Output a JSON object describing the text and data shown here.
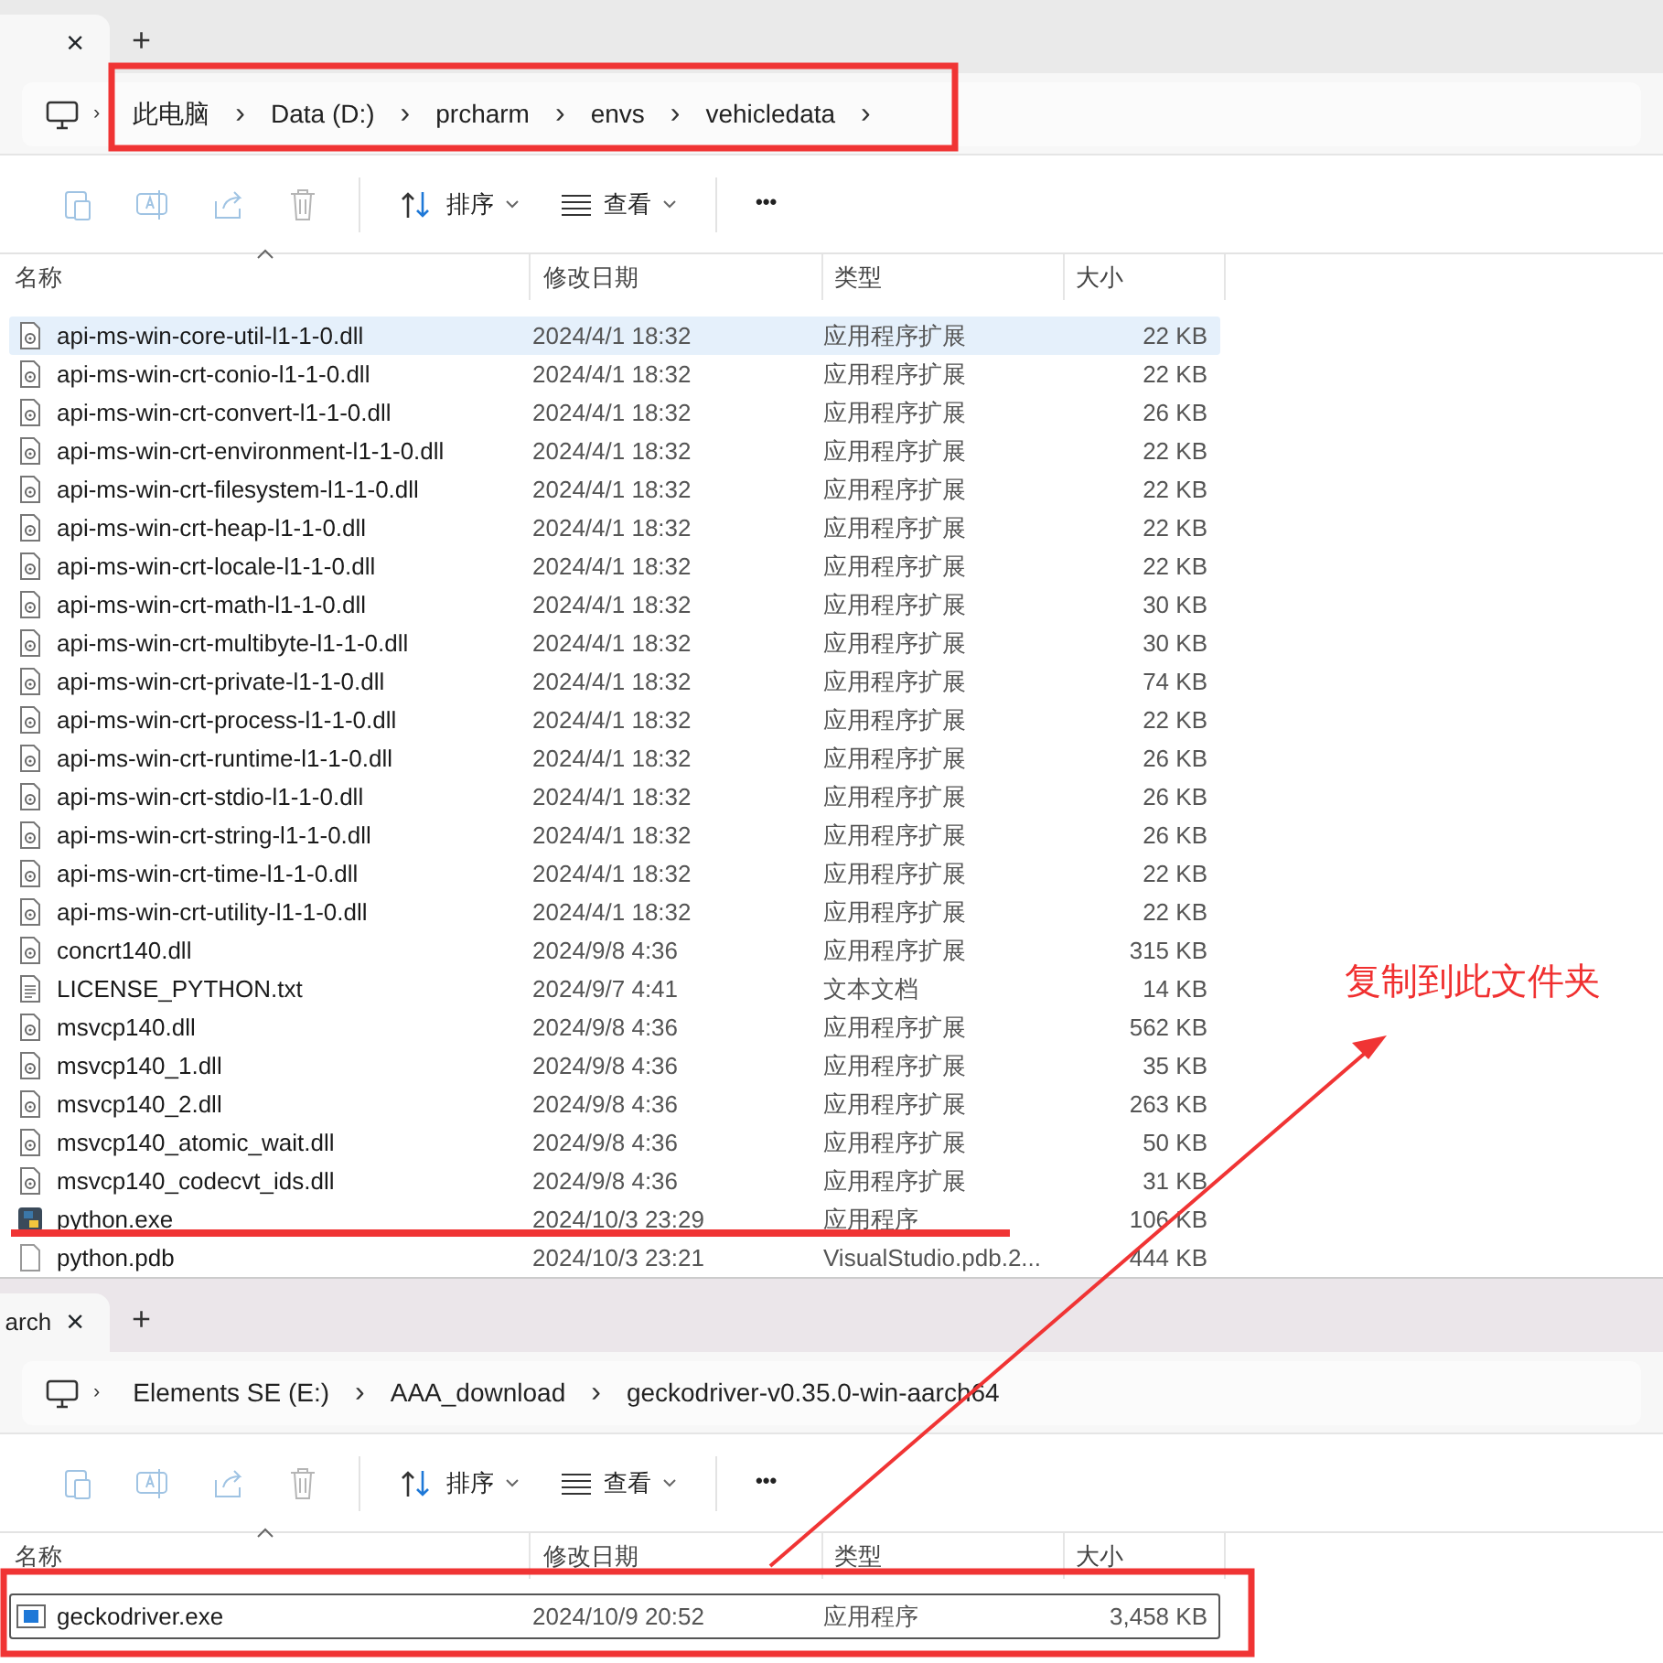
{
  "windows": [
    {
      "tab": {
        "close": "×"
      },
      "new_tab": "+",
      "path": [
        {
          "label": "此电脑"
        },
        {
          "label": "Data (D:)"
        },
        {
          "label": "prcharm"
        },
        {
          "label": "envs"
        },
        {
          "label": "vehicledata"
        }
      ],
      "path_lead": "›",
      "path_end": "›",
      "toolbar": {
        "sort": "排序",
        "view": "查看",
        "more": "•••"
      },
      "columns": [
        "名称",
        "修改日期",
        "类型",
        "大小"
      ],
      "rows": [
        {
          "kind": "dll",
          "name": "api-ms-win-core-util-l1-1-0.dll",
          "date": "2024/4/1 18:32",
          "type": "应用程序扩展",
          "size": "22 KB",
          "selected": true
        },
        {
          "kind": "dll",
          "name": "api-ms-win-crt-conio-l1-1-0.dll",
          "date": "2024/4/1 18:32",
          "type": "应用程序扩展",
          "size": "22 KB",
          "selected": false
        },
        {
          "kind": "dll",
          "name": "api-ms-win-crt-convert-l1-1-0.dll",
          "date": "2024/4/1 18:32",
          "type": "应用程序扩展",
          "size": "26 KB",
          "selected": false
        },
        {
          "kind": "dll",
          "name": "api-ms-win-crt-environment-l1-1-0.dll",
          "date": "2024/4/1 18:32",
          "type": "应用程序扩展",
          "size": "22 KB",
          "selected": false
        },
        {
          "kind": "dll",
          "name": "api-ms-win-crt-filesystem-l1-1-0.dll",
          "date": "2024/4/1 18:32",
          "type": "应用程序扩展",
          "size": "22 KB",
          "selected": false
        },
        {
          "kind": "dll",
          "name": "api-ms-win-crt-heap-l1-1-0.dll",
          "date": "2024/4/1 18:32",
          "type": "应用程序扩展",
          "size": "22 KB",
          "selected": false
        },
        {
          "kind": "dll",
          "name": "api-ms-win-crt-locale-l1-1-0.dll",
          "date": "2024/4/1 18:32",
          "type": "应用程序扩展",
          "size": "22 KB",
          "selected": false
        },
        {
          "kind": "dll",
          "name": "api-ms-win-crt-math-l1-1-0.dll",
          "date": "2024/4/1 18:32",
          "type": "应用程序扩展",
          "size": "30 KB",
          "selected": false
        },
        {
          "kind": "dll",
          "name": "api-ms-win-crt-multibyte-l1-1-0.dll",
          "date": "2024/4/1 18:32",
          "type": "应用程序扩展",
          "size": "30 KB",
          "selected": false
        },
        {
          "kind": "dll",
          "name": "api-ms-win-crt-private-l1-1-0.dll",
          "date": "2024/4/1 18:32",
          "type": "应用程序扩展",
          "size": "74 KB",
          "selected": false
        },
        {
          "kind": "dll",
          "name": "api-ms-win-crt-process-l1-1-0.dll",
          "date": "2024/4/1 18:32",
          "type": "应用程序扩展",
          "size": "22 KB",
          "selected": false
        },
        {
          "kind": "dll",
          "name": "api-ms-win-crt-runtime-l1-1-0.dll",
          "date": "2024/4/1 18:32",
          "type": "应用程序扩展",
          "size": "26 KB",
          "selected": false
        },
        {
          "kind": "dll",
          "name": "api-ms-win-crt-stdio-l1-1-0.dll",
          "date": "2024/4/1 18:32",
          "type": "应用程序扩展",
          "size": "26 KB",
          "selected": false
        },
        {
          "kind": "dll",
          "name": "api-ms-win-crt-string-l1-1-0.dll",
          "date": "2024/4/1 18:32",
          "type": "应用程序扩展",
          "size": "26 KB",
          "selected": false
        },
        {
          "kind": "dll",
          "name": "api-ms-win-crt-time-l1-1-0.dll",
          "date": "2024/4/1 18:32",
          "type": "应用程序扩展",
          "size": "22 KB",
          "selected": false
        },
        {
          "kind": "dll",
          "name": "api-ms-win-crt-utility-l1-1-0.dll",
          "date": "2024/4/1 18:32",
          "type": "应用程序扩展",
          "size": "22 KB",
          "selected": false
        },
        {
          "kind": "dll",
          "name": "concrt140.dll",
          "date": "2024/9/8 4:36",
          "type": "应用程序扩展",
          "size": "315 KB",
          "selected": false
        },
        {
          "kind": "txt",
          "name": "LICENSE_PYTHON.txt",
          "date": "2024/9/7 4:41",
          "type": "文本文档",
          "size": "14 KB",
          "selected": false
        },
        {
          "kind": "dll",
          "name": "msvcp140.dll",
          "date": "2024/9/8 4:36",
          "type": "应用程序扩展",
          "size": "562 KB",
          "selected": false
        },
        {
          "kind": "dll",
          "name": "msvcp140_1.dll",
          "date": "2024/9/8 4:36",
          "type": "应用程序扩展",
          "size": "35 KB",
          "selected": false
        },
        {
          "kind": "dll",
          "name": "msvcp140_2.dll",
          "date": "2024/9/8 4:36",
          "type": "应用程序扩展",
          "size": "263 KB",
          "selected": false
        },
        {
          "kind": "dll",
          "name": "msvcp140_atomic_wait.dll",
          "date": "2024/9/8 4:36",
          "type": "应用程序扩展",
          "size": "50 KB",
          "selected": false
        },
        {
          "kind": "dll",
          "name": "msvcp140_codecvt_ids.dll",
          "date": "2024/9/8 4:36",
          "type": "应用程序扩展",
          "size": "31 KB",
          "selected": false
        },
        {
          "kind": "python",
          "name": "python.exe",
          "date": "2024/10/3 23:29",
          "type": "应用程序",
          "size": "106 KB",
          "selected": false
        },
        {
          "kind": "blank",
          "name": "python.pdb",
          "date": "2024/10/3 23:21",
          "type": "VisualStudio.pdb.2...",
          "size": "444 KB",
          "selected": false
        }
      ]
    },
    {
      "tab": {
        "label": "arch",
        "close": "×"
      },
      "new_tab": "+",
      "path": [
        {
          "label": "Elements SE (E:)"
        },
        {
          "label": "AAA_download"
        },
        {
          "label": "geckodriver-v0.35.0-win-aarch64"
        }
      ],
      "path_lead": "›",
      "toolbar": {
        "sort": "排序",
        "view": "查看",
        "more": "•••"
      },
      "columns": [
        "名称",
        "修改日期",
        "类型",
        "大小"
      ],
      "rows": [
        {
          "kind": "exe",
          "name": "geckodriver.exe",
          "date": "2024/10/9 20:52",
          "type": "应用程序",
          "size": "3,458 KB",
          "selected": false,
          "focused": true
        }
      ]
    }
  ],
  "annotation": {
    "text": "复制到此文件夹"
  }
}
